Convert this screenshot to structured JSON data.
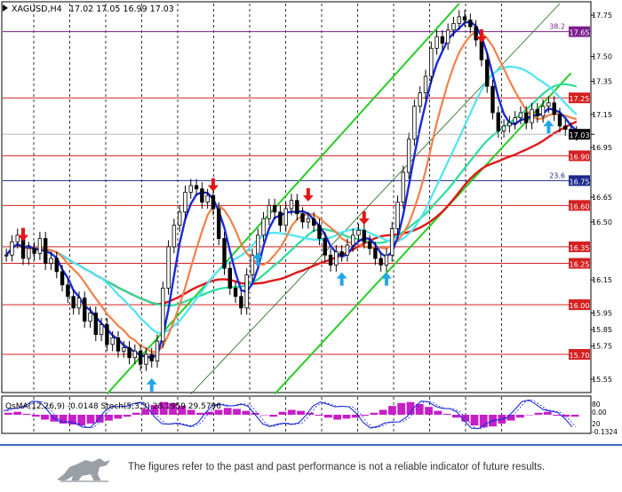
{
  "chart_data": {
    "type": "candlestick",
    "symbol": "XAGUSD,H4",
    "ohlc_header": "17.02 17.05 16.99 17.03",
    "current_price": "17.03",
    "y_ticks": [
      "17.75",
      "17.65",
      "17.50",
      "17.35",
      "17.25",
      "17.15",
      "17.03",
      "16.95",
      "16.90",
      "16.75",
      "16.65",
      "16.60",
      "16.50",
      "16.35",
      "16.25",
      "16.15",
      "16.00",
      "15.95",
      "15.85",
      "15.75",
      "15.70",
      "15.55"
    ],
    "ylim": [
      15.48,
      17.82
    ],
    "level_lines": [
      {
        "price": 17.65,
        "label": "17.65",
        "color": "#7b1f8c",
        "fib": "38.2"
      },
      {
        "price": 17.25,
        "label": "17.25",
        "color": "#d42020"
      },
      {
        "price": 16.9,
        "label": "16.90",
        "color": "#d42020"
      },
      {
        "price": 16.75,
        "label": "16.75",
        "color": "#1c2a8c",
        "fib": "23.6"
      },
      {
        "price": 16.6,
        "label": "16.60",
        "color": "#d42020"
      },
      {
        "price": 16.35,
        "label": "16.35",
        "color": "#d42020"
      },
      {
        "price": 16.25,
        "label": "16.25",
        "color": "#d42020"
      },
      {
        "price": 16.0,
        "label": "16.00",
        "color": "#d42020"
      },
      {
        "price": 15.7,
        "label": "15.70",
        "color": "#d42020"
      }
    ],
    "close_series": [
      16.3,
      16.38,
      16.42,
      16.28,
      16.34,
      16.31,
      16.4,
      16.25,
      16.28,
      16.2,
      16.12,
      16.05,
      15.98,
      16.04,
      15.9,
      15.95,
      15.82,
      15.88,
      15.76,
      15.8,
      15.72,
      15.74,
      15.68,
      15.72,
      15.64,
      15.7,
      15.66,
      15.78,
      16.1,
      16.35,
      16.48,
      16.56,
      16.68,
      16.72,
      16.7,
      16.62,
      16.66,
      16.58,
      16.4,
      16.22,
      16.1,
      16.05,
      15.98,
      16.18,
      16.3,
      16.42,
      16.52,
      16.6,
      16.56,
      16.48,
      16.58,
      16.63,
      16.55,
      16.5,
      16.52,
      16.48,
      16.4,
      16.3,
      16.24,
      16.32,
      16.3,
      16.36,
      16.42,
      16.45,
      16.38,
      16.34,
      16.28,
      16.24,
      16.3,
      16.46,
      16.62,
      16.8,
      17.0,
      17.2,
      17.28,
      17.38,
      17.55,
      17.62,
      17.58,
      17.66,
      17.7,
      17.74,
      17.72,
      17.68,
      17.6,
      17.48,
      17.32,
      17.16,
      17.05,
      17.08,
      17.1,
      17.13,
      17.16,
      17.1,
      17.18,
      17.14,
      17.2,
      17.22,
      17.15,
      17.08,
      17.06,
      17.04,
      17.03
    ],
    "indicator_label": "OsMA(12,26,9) -0.0148  Stoch(5,3,3) 28.1959 29.5796",
    "indicator_ticks": [
      "80",
      "0.00",
      "20",
      "-0.1324"
    ],
    "osma_values": [
      0.02,
      0.03,
      0.01,
      -0.02,
      -0.05,
      -0.07,
      -0.09,
      -0.1,
      -0.11,
      -0.09,
      -0.08,
      -0.06,
      -0.04,
      -0.02,
      0.02,
      0.06,
      0.1,
      0.13,
      0.12,
      0.09,
      0.05,
      0.02,
      0.03,
      0.05,
      0.07,
      0.06,
      0.04,
      0.02,
      0.0,
      -0.02,
      0.03,
      0.05,
      0.04,
      0.02,
      -0.01,
      -0.03,
      -0.05,
      -0.04,
      -0.03,
      -0.01,
      0.02,
      0.05,
      0.09,
      0.12,
      0.13,
      0.11,
      0.08,
      0.04,
      0.01,
      -0.03,
      -0.07,
      -0.11,
      -0.13,
      -0.12,
      -0.09,
      -0.06,
      -0.03,
      0.0,
      0.02,
      0.03,
      -0.01,
      -0.02,
      -0.02
    ]
  },
  "disclaimer": {
    "text": "The figures refer to the past and past performance is not a reliable indicator of future results."
  },
  "colors": {
    "grid": "#000000",
    "bull_candle": "#000000",
    "ma_blue": "#1a2ad6",
    "ma_cyan": "#4ee4f4",
    "ma_red": "#e01818",
    "ma_orange": "#f0804a",
    "ma_green": "#2ddc9a",
    "channel": "#28cc28",
    "arrow_down": "#e61414",
    "arrow_up": "#21a6e8",
    "osma": "#c81ec8",
    "stoch": "#1a2ad6"
  }
}
